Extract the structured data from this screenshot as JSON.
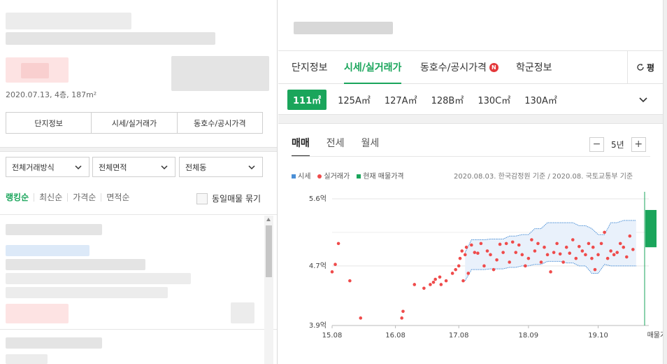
{
  "left": {
    "meta_line": "2020.07.13, 4층, 187m²",
    "segment_tabs": [
      "단지정보",
      "시세/실거래가",
      "동호수/공시가격"
    ],
    "filters": [
      "전체거래방식",
      "전체면적",
      "전체동"
    ],
    "sort_options": [
      "랭킹순",
      "최신순",
      "가격순",
      "면적순"
    ],
    "group_checkbox_label": "동일매물 묶기"
  },
  "right": {
    "tabs": [
      "단지정보",
      "시세/실거래가",
      "동호수/공시가격",
      "학군정보"
    ],
    "active_tab": "시세/실거래가",
    "new_badge": "N",
    "right_tab_label": "평",
    "areas": [
      {
        "label": "111㎡",
        "active": true
      },
      {
        "label": "125A㎡"
      },
      {
        "label": "127A㎡"
      },
      {
        "label": "128B㎡"
      },
      {
        "label": "130C㎡"
      },
      {
        "label": "130A㎡"
      }
    ],
    "deal_tabs": [
      "매매",
      "전세",
      "월세"
    ],
    "zoom": {
      "minus": "−",
      "value": "5년",
      "plus": "+"
    },
    "legend": [
      {
        "label": "시세",
        "color": "#4a8fd6",
        "shape": "square"
      },
      {
        "label": "실거래가",
        "color": "#ef4b4b",
        "shape": "dot"
      },
      {
        "label": "현재 매물가격",
        "color": "#1aa55b",
        "shape": "square"
      }
    ],
    "source_note": "2020.08.03. 한국감정원 기준 / 2020.08. 국토교통부 기준"
  },
  "chart_data": {
    "type": "scatter",
    "xlabel": "",
    "ylabel": "",
    "x_tick_labels": [
      "15.08",
      "16.08",
      "17.08",
      "18.09",
      "19.10",
      "매물가격"
    ],
    "x_ticks": [
      2015.6,
      2016.6,
      2017.6,
      2018.7,
      2019.8
    ],
    "y_tick_labels": [
      "5.6억",
      "4.7억",
      "3.9억"
    ],
    "y_ticks": [
      5.6,
      4.7,
      3.9
    ],
    "ylim": [
      3.9,
      5.6
    ],
    "xlim": [
      2015.6,
      2020.6
    ],
    "grid": true,
    "series": [
      {
        "name": "시세",
        "type": "band",
        "color": "#4a8fd6",
        "x": [
          2017.7,
          2017.8,
          2017.9,
          2018.0,
          2018.1,
          2018.2,
          2018.3,
          2018.4,
          2018.5,
          2018.6,
          2018.7,
          2018.8,
          2018.9,
          2019.0,
          2019.1,
          2019.2,
          2019.3,
          2019.4,
          2019.5,
          2019.6,
          2019.7,
          2019.8,
          2019.9,
          2020.0,
          2020.1,
          2020.2,
          2020.3,
          2020.4
        ],
        "upper": [
          4.88,
          5.05,
          5.05,
          5.05,
          5.06,
          5.06,
          5.06,
          5.1,
          5.1,
          5.12,
          5.12,
          5.2,
          5.2,
          5.28,
          5.28,
          5.28,
          5.28,
          5.28,
          5.24,
          5.24,
          5.2,
          5.12,
          5.12,
          5.28,
          5.28,
          5.31,
          5.31,
          5.31
        ],
        "lower": [
          4.5,
          4.65,
          4.65,
          4.65,
          4.66,
          4.66,
          4.66,
          4.68,
          4.68,
          4.7,
          4.7,
          4.72,
          4.72,
          4.76,
          4.76,
          4.76,
          4.74,
          4.74,
          4.7,
          4.7,
          4.6,
          4.6,
          4.72,
          4.7,
          4.7,
          4.7,
          4.7,
          4.7
        ]
      },
      {
        "name": "실거래가",
        "type": "scatter",
        "color": "#ef4b4b",
        "x": [
          2015.6,
          2015.65,
          2015.7,
          2015.88,
          2016.05,
          2016.7,
          2016.72,
          2016.9,
          2017.05,
          2017.15,
          2017.2,
          2017.23,
          2017.3,
          2017.32,
          2017.4,
          2017.5,
          2017.55,
          2017.6,
          2017.62,
          2017.65,
          2017.67,
          2017.7,
          2017.72,
          2017.75,
          2017.8,
          2017.85,
          2017.9,
          2017.95,
          2018.0,
          2018.05,
          2018.1,
          2018.15,
          2018.2,
          2018.25,
          2018.3,
          2018.35,
          2018.4,
          2018.45,
          2018.5,
          2018.55,
          2018.6,
          2018.65,
          2018.7,
          2018.75,
          2018.8,
          2018.85,
          2018.9,
          2018.95,
          2019.0,
          2019.05,
          2019.1,
          2019.15,
          2019.2,
          2019.25,
          2019.3,
          2019.35,
          2019.4,
          2019.45,
          2019.5,
          2019.55,
          2019.6,
          2019.65,
          2019.7,
          2019.72,
          2019.75,
          2019.8,
          2019.85,
          2019.9,
          2019.95,
          2020.0,
          2020.05,
          2020.1,
          2020.15,
          2020.2,
          2020.25,
          2020.3,
          2020.35
        ],
        "y": [
          4.62,
          4.72,
          5.0,
          4.5,
          4.0,
          4.0,
          4.09,
          4.45,
          4.4,
          4.45,
          4.48,
          4.52,
          4.55,
          4.45,
          4.5,
          4.6,
          4.65,
          4.7,
          4.8,
          4.9,
          4.5,
          4.85,
          4.95,
          4.6,
          4.98,
          4.88,
          4.87,
          5.0,
          4.7,
          4.9,
          4.85,
          4.65,
          4.78,
          4.99,
          4.88,
          5.0,
          4.75,
          5.02,
          4.88,
          4.98,
          4.85,
          4.7,
          4.8,
          5.05,
          4.9,
          5.0,
          4.75,
          4.95,
          4.85,
          4.62,
          4.88,
          5.0,
          4.86,
          4.75,
          4.95,
          4.87,
          5.05,
          4.8,
          4.96,
          4.9,
          4.85,
          5.0,
          4.8,
          4.95,
          4.65,
          4.85,
          5.0,
          5.15,
          4.8,
          4.9,
          4.85,
          4.88,
          5.0,
          4.95,
          4.82,
          5.1,
          4.92
        ]
      },
      {
        "name": "현재 매물가격",
        "type": "range",
        "color": "#1aa55b",
        "x": 2020.6,
        "low": 4.95,
        "high": 5.45
      }
    ]
  }
}
